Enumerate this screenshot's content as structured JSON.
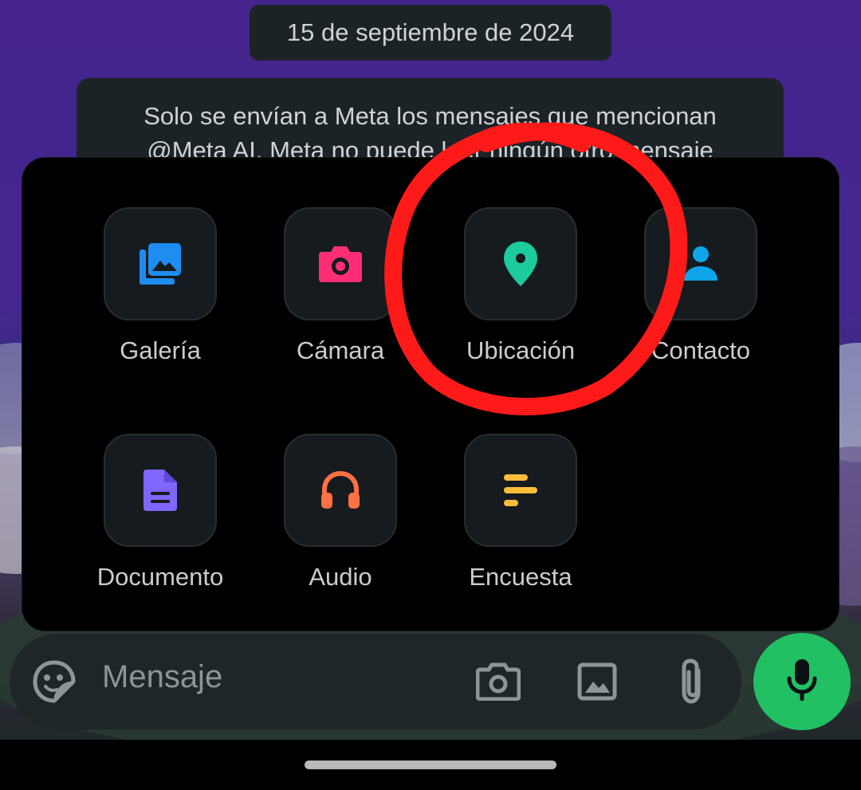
{
  "chat": {
    "date_chip": "15 de septiembre de 2024",
    "info_line1": "Solo se envían a Meta los mensajes que mencionan",
    "info_line2": "@Meta AI. Meta no puede leer ningún otro mensaje"
  },
  "attach_menu": {
    "items": [
      {
        "label": "Galería",
        "icon": "gallery-icon",
        "color": "#1f8cf0"
      },
      {
        "label": "Cámara",
        "icon": "camera-icon",
        "color": "#ff2e74"
      },
      {
        "label": "Ubicación",
        "icon": "location-pin-icon",
        "color": "#1ecb9d"
      },
      {
        "label": "Contacto",
        "icon": "contact-icon",
        "color": "#0ea5e9"
      },
      {
        "label": "Documento",
        "icon": "document-icon",
        "color": "#7f66ff"
      },
      {
        "label": "Audio",
        "icon": "headphones-icon",
        "color": "#ff7043"
      },
      {
        "label": "Encuesta",
        "icon": "poll-icon",
        "color": "#ffbc38"
      }
    ]
  },
  "annotation": {
    "color": "#ff1a1a",
    "highlight_target": "Ubicación"
  },
  "composer": {
    "placeholder": "Mensaje",
    "accent": "#21c063"
  }
}
